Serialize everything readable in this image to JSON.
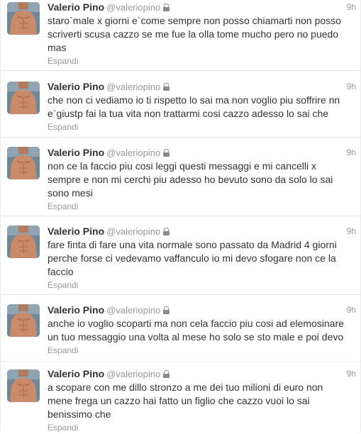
{
  "tweets": [
    {
      "fullname": "Valerio Pino",
      "username": "@valeriopino",
      "time": "9h",
      "text": "staro`male x giorni e`come sempre non posso chiamarti non posso scriverti scusa cazzo se me fue la olla tome mucho pero no puedo mas",
      "expand": "Espandi"
    },
    {
      "fullname": "Valerio Pino",
      "username": "@valeriopino",
      "time": "9h",
      "text": "che non ci vediamo io ti rispetto lo sai ma non voglio piu soffrire nn e`giustp fai la tua vita non trattarmi cosi cazzo adesso lo sai che",
      "expand": "Espandi"
    },
    {
      "fullname": "Valerio Pino",
      "username": "@valeriopino",
      "time": "9h",
      "text": "non ce la faccio piu cosi leggi questi messaggi e mi cancelli x sempre e non mi cerchi piu adesso ho bevuto sono da solo lo sai sono mesi",
      "expand": "Espandi"
    },
    {
      "fullname": "Valerio Pino",
      "username": "@valeriopino",
      "time": "9h",
      "text": "fare finta di fare una vita normale sono passato da Madrid 4 giorni perche forse ci vedevamo vaffanculo io mi devo sfogare non ce la faccio",
      "expand": "Espandi"
    },
    {
      "fullname": "Valerio Pino",
      "username": "@valeriopino",
      "time": "9h",
      "text": "anche io voglio scoparti ma non cela faccio piu cosi ad elemosinare un tuo messaggio una volta al mese ho solo se sto male e poi devo",
      "expand": "Espandi"
    },
    {
      "fullname": "Valerio Pino",
      "username": "@valeriopino",
      "time": "9h",
      "text": "a scopare con me dillo stronzo a me dei tuo milioni di euro non mene frega un cazzo hai fatto un figlio che cazzo vuoi lo sai benissimo che",
      "expand": "Espandi"
    }
  ],
  "icons": {
    "protected": "lock-icon",
    "avatar": "profile-photo"
  }
}
